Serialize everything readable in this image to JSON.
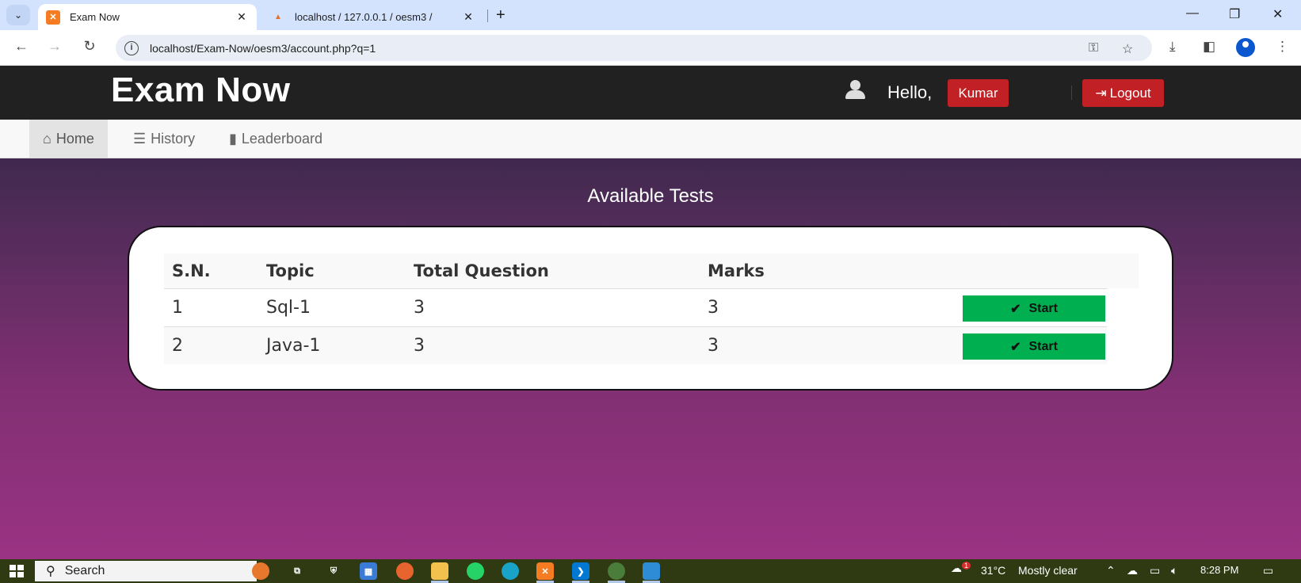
{
  "browser": {
    "tabs": [
      {
        "title": "Exam Now",
        "favicon": "xampp-icon"
      },
      {
        "title": "localhost / 127.0.0.1 / oesm3 / ",
        "favicon": "phpmyadmin-icon"
      }
    ],
    "url": "localhost/Exam-Now/oesm3/account.php?q=1"
  },
  "header": {
    "logo": "Exam Now",
    "hello": "Hello,",
    "username": "Kumar",
    "logout": "Logout"
  },
  "nav": {
    "items": [
      {
        "label": "Home",
        "icon": "home-icon",
        "active": true
      },
      {
        "label": "History",
        "icon": "list-icon",
        "active": false
      },
      {
        "label": "Leaderboard",
        "icon": "bar-chart-icon",
        "active": false
      }
    ]
  },
  "main": {
    "title": "Available Tests",
    "table": {
      "headers": [
        "S.N.",
        "Topic",
        "Total Question",
        "Marks"
      ],
      "rows": [
        {
          "sn": "1",
          "topic": "Sql-1",
          "total": "3",
          "marks": "3",
          "action": "Start"
        },
        {
          "sn": "2",
          "topic": "Java-1",
          "total": "3",
          "marks": "3",
          "action": "Start"
        }
      ]
    }
  },
  "taskbar": {
    "search": "Search",
    "weather": "31°C",
    "weather_text": "Mostly clear",
    "time": "8:28 PM",
    "notification_count": "1"
  },
  "colors": {
    "header_bg": "#212121",
    "danger": "#c12025",
    "start_green": "#00b050",
    "gradient_top": "#25233b",
    "gradient_bottom": "#9a3383"
  }
}
